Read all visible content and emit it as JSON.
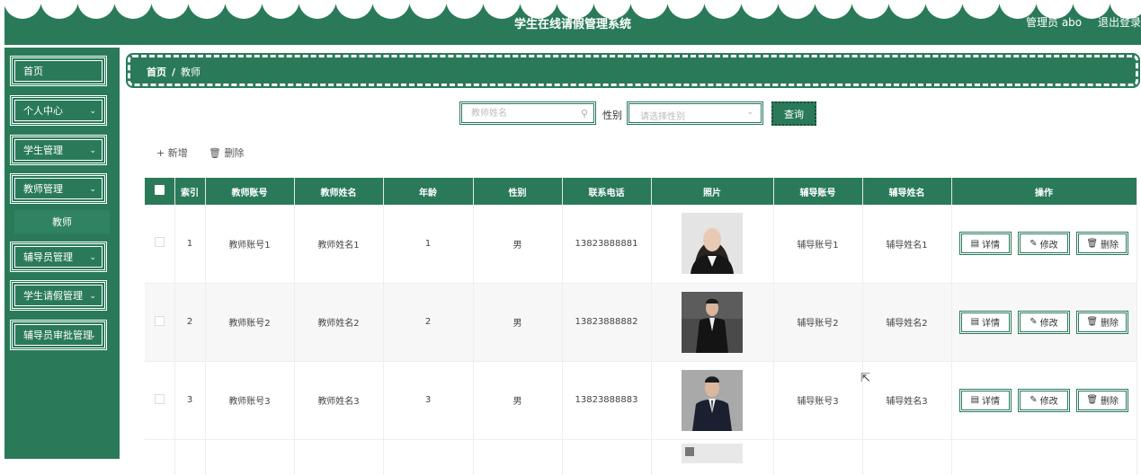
{
  "header": {
    "title": "学生在线请假管理系统",
    "user": "管理员 abo",
    "logout": "退出登录"
  },
  "sidebar": {
    "items": [
      {
        "label": "首页",
        "has_arrow": false
      },
      {
        "label": "个人中心",
        "has_arrow": true
      },
      {
        "label": "学生管理",
        "has_arrow": true
      },
      {
        "label": "教师管理",
        "has_arrow": true
      },
      {
        "label": "辅导员管理",
        "has_arrow": true
      },
      {
        "label": "学生请假管理",
        "has_arrow": true
      },
      {
        "label": "辅导员审批管理",
        "has_arrow": true
      }
    ],
    "submenu": {
      "label": "教师"
    }
  },
  "breadcrumb": {
    "home": "首页",
    "separator": "/",
    "current": "教师"
  },
  "search": {
    "name_placeholder": "教师姓名",
    "gender_label": "性别",
    "gender_placeholder": "请选择性别",
    "query_label": "查询"
  },
  "toolbar": {
    "add_label": "+ 新增",
    "delete_label": "删除"
  },
  "table": {
    "headers": [
      "索引",
      "教师账号",
      "教师姓名",
      "年龄",
      "性别",
      "联系电话",
      "照片",
      "辅导账号",
      "辅导姓名",
      "操作"
    ],
    "rows": [
      {
        "index": "1",
        "account": "教师账号1",
        "name": "教师姓名1",
        "age": "1",
        "gender": "男",
        "phone": "13823888881",
        "counselor_account": "辅导账号1",
        "counselor_name": "辅导姓名1"
      },
      {
        "index": "2",
        "account": "教师账号2",
        "name": "教师姓名2",
        "age": "2",
        "gender": "男",
        "phone": "13823888882",
        "counselor_account": "辅导账号2",
        "counselor_name": "辅导姓名2"
      },
      {
        "index": "3",
        "account": "教师账号3",
        "name": "教师姓名3",
        "age": "3",
        "gender": "男",
        "phone": "13823888883",
        "counselor_account": "辅导账号3",
        "counselor_name": "辅导姓名3"
      }
    ],
    "actions": {
      "detail": "详情",
      "edit": "修改",
      "delete": "删除"
    }
  },
  "colors": {
    "primary": "#2a7a5a",
    "header_text": "#ffffff",
    "row_alt": "#f7f7f7"
  }
}
